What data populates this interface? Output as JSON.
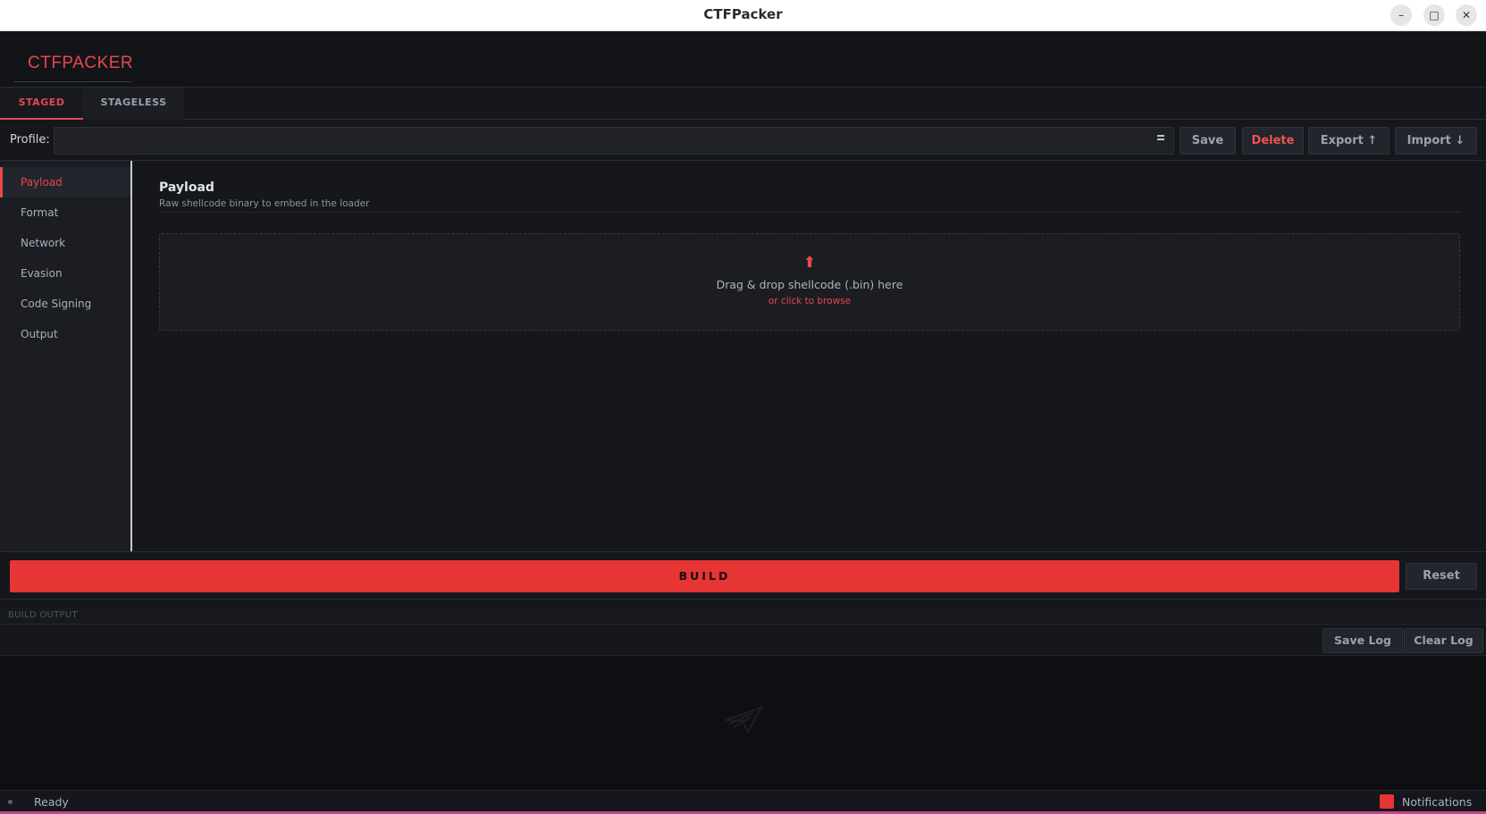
{
  "window": {
    "title": "CTFPacker",
    "minimize_glyph": "–",
    "maximize_glyph": "□",
    "close_glyph": "✕"
  },
  "header": {
    "logo_text": "CTFPACKER",
    "right_faint": "· · ·"
  },
  "mode_tabs": [
    {
      "label": "STAGED",
      "active": true
    },
    {
      "label": "STAGELESS",
      "active": false
    }
  ],
  "profile": {
    "label": "Profile:",
    "selected": "",
    "buttons": {
      "save": "Save",
      "delete": "Delete",
      "export": "Export ↑",
      "import": "Import ↓"
    }
  },
  "sidebar": {
    "items": [
      {
        "label": "Payload",
        "active": true
      },
      {
        "label": "Format",
        "active": false
      },
      {
        "label": "Network",
        "active": false
      },
      {
        "label": "Evasion",
        "active": false
      },
      {
        "label": "Code Signing",
        "active": false
      },
      {
        "label": "Output",
        "active": false
      }
    ]
  },
  "content": {
    "title": "Payload",
    "subtitle": "Raw shellcode binary to embed in the loader",
    "dropzone": {
      "icon": "⬆",
      "text": "Drag & drop shellcode (.bin) here",
      "link": "or click to browse"
    }
  },
  "build": {
    "build_label": "BUILD",
    "reset_label": "Reset"
  },
  "output": {
    "label": "BUILD OUTPUT",
    "save_log": "Save Log",
    "clear_log": "Clear Log"
  },
  "status": {
    "text": "Ready",
    "notifications": "Notifications"
  },
  "colors": {
    "accent": "#e5484d",
    "build_button": "#e53535",
    "background": "#15171c",
    "status_underline": "#c2458f"
  }
}
